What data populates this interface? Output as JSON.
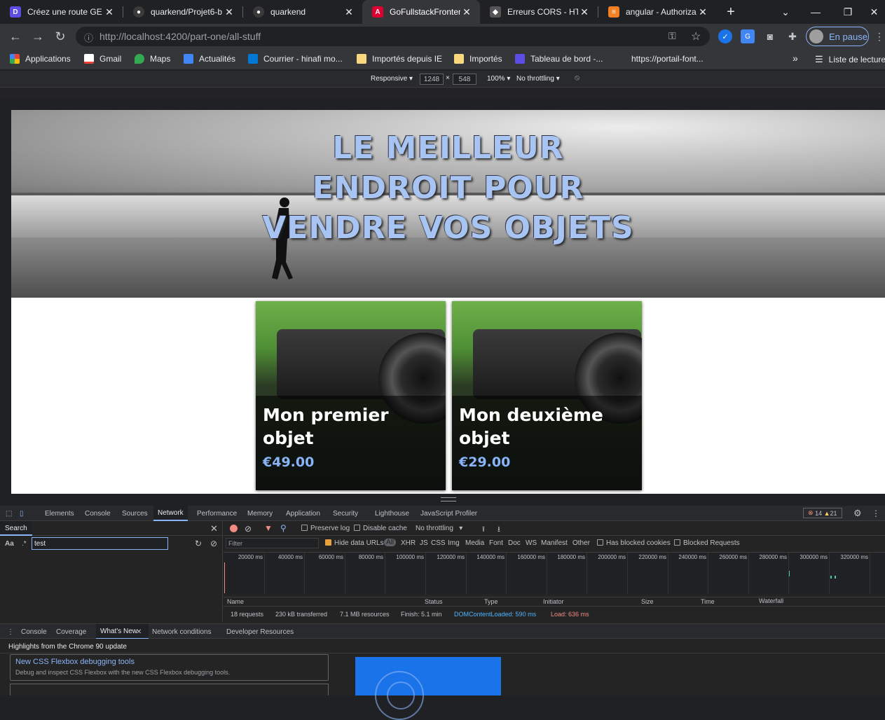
{
  "browser": {
    "tabs": [
      {
        "title": "Créez une route GE",
        "favicon_color": "#5c4ee5",
        "favicon_glyph": "D",
        "active": false
      },
      {
        "title": "quarkend/Projet6-b",
        "favicon_color": "#2b2b2b",
        "favicon_glyph": "◯",
        "active": false
      },
      {
        "title": "quarkend",
        "favicon_color": "#2b2b2b",
        "favicon_glyph": "◯",
        "active": false
      },
      {
        "title": "GoFullstackFronten",
        "favicon_color": "#dd0031",
        "favicon_glyph": "A",
        "active": true
      },
      {
        "title": "Erreurs CORS - HTT",
        "favicon_color": "#2b2b2b",
        "favicon_glyph": "◆",
        "active": false
      },
      {
        "title": "angular - Authoriza",
        "favicon_color": "#f48024",
        "favicon_glyph": "≡",
        "active": false
      }
    ],
    "new_tab": "+",
    "url": "http://localhost:4200/part-one/all-stuff",
    "profile_label": "En pause",
    "bookmarks": [
      {
        "label": "Applications",
        "icon": "apps-grid-icon",
        "color": "#ea4335"
      },
      {
        "label": "Gmail",
        "icon": "gmail-icon",
        "color": "#ea4335"
      },
      {
        "label": "Maps",
        "icon": "maps-pin-icon",
        "color": "#34a853"
      },
      {
        "label": "Actualités",
        "icon": "news-icon",
        "color": "#4285f4"
      },
      {
        "label": "Courrier - hinafi mo...",
        "icon": "outlook-icon",
        "color": "#0078d4"
      },
      {
        "label": "Importés depuis IE",
        "icon": "folder-icon",
        "color": "#f9d77e"
      },
      {
        "label": "Importés",
        "icon": "folder-icon",
        "color": "#f9d77e"
      },
      {
        "label": "Tableau de bord -...",
        "icon": "dashboard-icon",
        "color": "#5c4ee5"
      },
      {
        "label": "https://portail-font...",
        "icon": "",
        "color": ""
      }
    ],
    "more_bookmarks": "»",
    "reading_list": "Liste de lecture"
  },
  "device_toolbar": {
    "mode": "Responsive",
    "width": "1248",
    "times": "×",
    "height": "548",
    "zoom": "100%",
    "throttle": "No throttling"
  },
  "page": {
    "hero_lines": [
      "LE MEILLEUR",
      "ENDROIT POUR",
      "VENDRE VOS OBJETS"
    ],
    "items": [
      {
        "title": "Mon premier objet",
        "price": "€49.00"
      },
      {
        "title": "Mon deuxième objet",
        "price": "€29.00"
      }
    ]
  },
  "devtools": {
    "tabs": [
      "Elements",
      "Console",
      "Sources",
      "Network",
      "Performance",
      "Memory",
      "Application",
      "Security",
      "Lighthouse",
      "JavaScript Profiler"
    ],
    "active_tab": "Network",
    "errors": "14",
    "warnings": "21",
    "search": {
      "title": "Search",
      "case_label": "Aa",
      "regex_label": ".*",
      "query": "test"
    },
    "network": {
      "preserve_log": "Preserve log",
      "disable_cache": "Disable cache",
      "throttling": "No throttling",
      "filter_placeholder": "Filter",
      "hide_data_urls": "Hide data URLs",
      "types": [
        "All",
        "XHR",
        "JS",
        "CSS",
        "Img",
        "Media",
        "Font",
        "Doc",
        "WS",
        "Manifest",
        "Other"
      ],
      "has_blocked_cookies": "Has blocked cookies",
      "blocked_requests": "Blocked Requests",
      "timeline_ticks": [
        "20000 ms",
        "40000 ms",
        "60000 ms",
        "80000 ms",
        "100000 ms",
        "120000 ms",
        "140000 ms",
        "160000 ms",
        "180000 ms",
        "200000 ms",
        "220000 ms",
        "240000 ms",
        "260000 ms",
        "280000 ms",
        "300000 ms",
        "320000 ms"
      ],
      "columns": [
        "Name",
        "Status",
        "Type",
        "Initiator",
        "Size",
        "Time",
        "Waterfall"
      ],
      "summary": {
        "requests": "18 requests",
        "transferred": "230 kB transferred",
        "resources": "7.1 MB resources",
        "finish": "Finish: 5.1 min",
        "dom": "DOMContentLoaded: 590 ms",
        "load": "Load: 636 ms"
      }
    },
    "drawer": {
      "tabs": [
        "Console",
        "Coverage",
        "What's New",
        "Network conditions",
        "Developer Resources"
      ],
      "active_tab": "What's New",
      "highlight_title": "Highlights from the Chrome 90 update",
      "card_title": "New CSS Flexbox debugging tools",
      "card_desc": "Debug and inspect CSS Flexbox with the new CSS Flexbox debugging tools."
    }
  }
}
